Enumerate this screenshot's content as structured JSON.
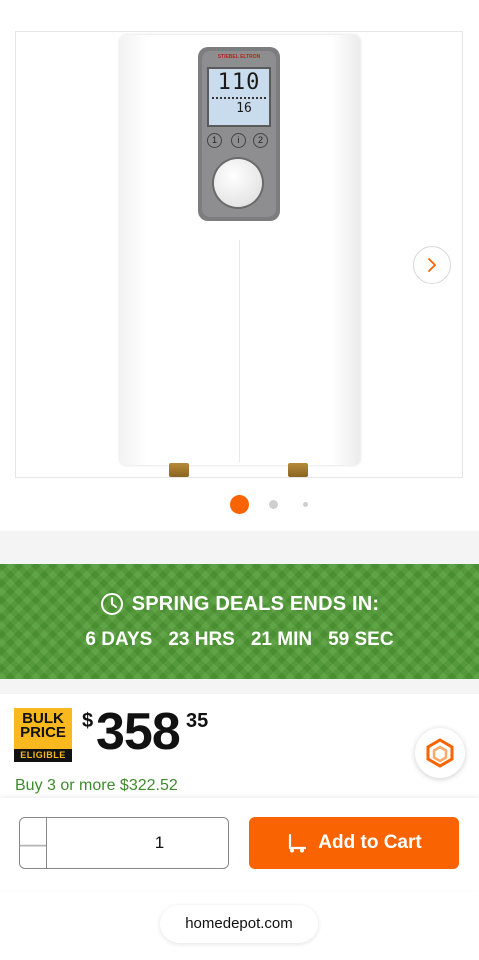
{
  "product": {
    "brand_label": "STIEBEL ELTRON",
    "display_temp": "110",
    "display_flow": "16",
    "panel_buttons": [
      "1",
      "i",
      "2"
    ]
  },
  "gallery": {
    "dot_count": 3,
    "active_dot": 0
  },
  "promo": {
    "title": "SPRING DEALS ENDS IN:",
    "countdown": [
      "6 DAYS",
      "23 HRS",
      "21 MIN",
      "59 SEC"
    ],
    "background_color": "#4f9a34"
  },
  "pricing": {
    "badge_line1": "BULK",
    "badge_line2": "PRICE",
    "badge_line3": "ELIGIBLE",
    "currency": "$",
    "dollars": "358",
    "cents": "35",
    "bulk_offer": "Buy 3 or more $322.52"
  },
  "cart": {
    "quantity": "1",
    "minus_symbol": "—",
    "plus_symbol": "+",
    "add_label": "Add to Cart",
    "accent_color": "#f96302"
  },
  "browser": {
    "url": "homedepot.com"
  },
  "icons": {
    "next": "chevron-right-icon",
    "clock": "clock-icon",
    "cart": "dolly-cart-icon",
    "floating": "hexagon-logo-icon"
  }
}
